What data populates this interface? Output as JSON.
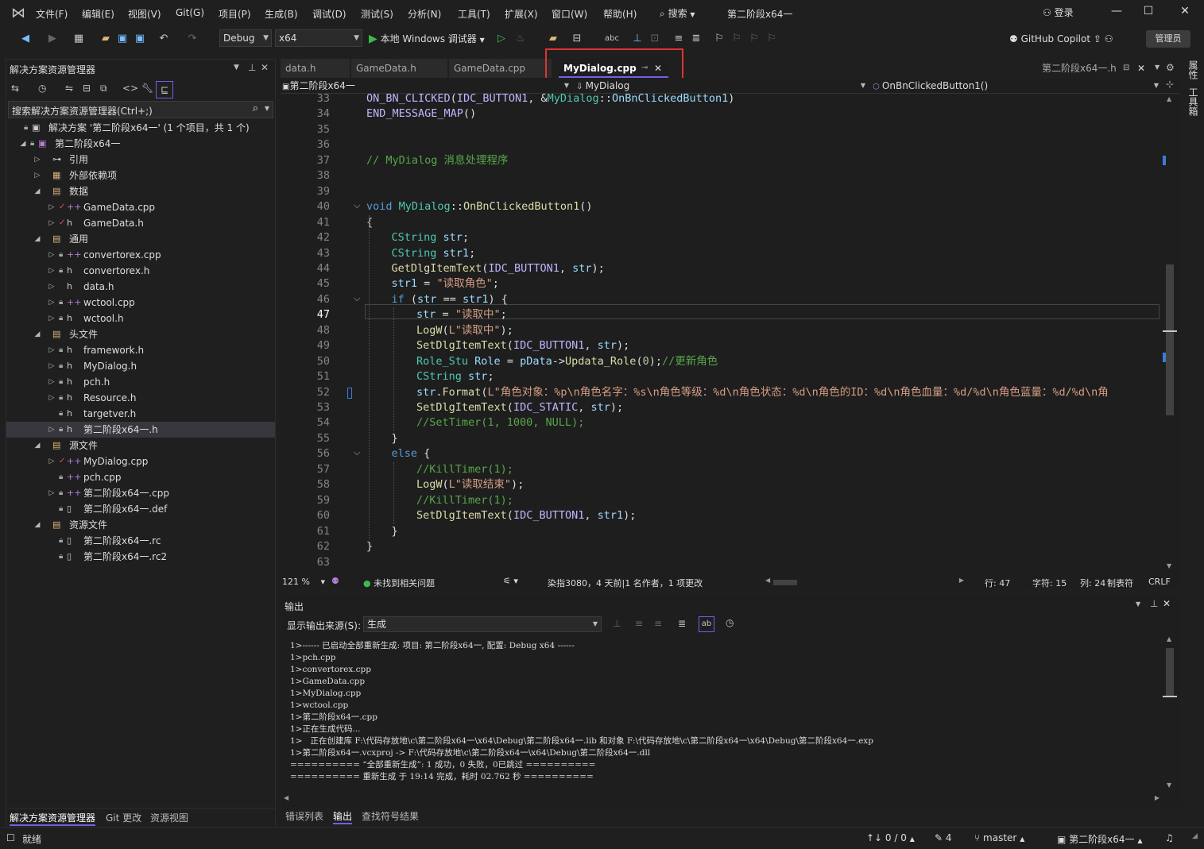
{
  "menu": [
    "文件(F)",
    "编辑(E)",
    "视图(V)",
    "Git(G)",
    "项目(P)",
    "生成(B)",
    "调试(D)",
    "测试(S)",
    "分析(N)",
    "工具(T)",
    "扩展(X)",
    "窗口(W)",
    "帮助(H)"
  ],
  "search_label": "搜索",
  "window_title": "第二阶段x64一",
  "signin": "登录",
  "toolbar": {
    "config": "Debug",
    "platform": "x64",
    "run_label": "本地 Windows 调试器",
    "copilot": "GitHub Copilot",
    "admin": "管理员"
  },
  "solution": {
    "title": "解决方案资源管理器",
    "search_placeholder": "搜索解决方案资源管理器(Ctrl+;)",
    "rows": [
      {
        "label": "解决方案 '第二阶段x64一' (1 个项目，共 1 个)",
        "glyph": "▣"
      },
      {
        "label": "第二阶段x64一",
        "glyph": "▣"
      },
      {
        "label": "引用",
        "glyph": "⊶"
      },
      {
        "label": "外部依赖项",
        "glyph": "▦"
      },
      {
        "label": "数据",
        "glyph": "▤"
      },
      {
        "label": "GameData.cpp",
        "glyph": "++"
      },
      {
        "label": "GameData.h",
        "glyph": "h"
      },
      {
        "label": "通用",
        "glyph": "▤"
      },
      {
        "label": "convertorex.cpp",
        "glyph": "++"
      },
      {
        "label": "convertorex.h",
        "glyph": "h"
      },
      {
        "label": "data.h",
        "glyph": "h"
      },
      {
        "label": "wctool.cpp",
        "glyph": "++"
      },
      {
        "label": "wctool.h",
        "glyph": "h"
      },
      {
        "label": "头文件",
        "glyph": "▤"
      },
      {
        "label": "framework.h",
        "glyph": "h"
      },
      {
        "label": "MyDialog.h",
        "glyph": "h"
      },
      {
        "label": "pch.h",
        "glyph": "h"
      },
      {
        "label": "Resource.h",
        "glyph": "h"
      },
      {
        "label": "targetver.h",
        "glyph": "h"
      },
      {
        "label": "第二阶段x64一.h",
        "glyph": "h"
      },
      {
        "label": "源文件",
        "glyph": "▤"
      },
      {
        "label": "MyDialog.cpp",
        "glyph": "++"
      },
      {
        "label": "pch.cpp",
        "glyph": "++"
      },
      {
        "label": "第二阶段x64一.cpp",
        "glyph": "++"
      },
      {
        "label": "第二阶段x64一.def",
        "glyph": "▯"
      },
      {
        "label": "资源文件",
        "glyph": "▤"
      },
      {
        "label": "第二阶段x64一.rc",
        "glyph": "▯"
      },
      {
        "label": "第二阶段x64一.rc2",
        "glyph": "▯"
      }
    ],
    "bottom_tabs": [
      "解决方案资源管理器",
      "Git 更改",
      "资源视图"
    ]
  },
  "editor": {
    "tabs": [
      "data.h",
      "GameData.h",
      "GameData.cpp",
      "MyDialog.cpp"
    ],
    "right_tab": "第二阶段x64一.h",
    "nav": {
      "project": "第二阶段x64一",
      "scope": "MyDialog",
      "member": "OnBnClickedButton1()"
    },
    "line_numbers": [
      "33",
      "34",
      "35",
      "36",
      "37",
      "38",
      "39",
      "40",
      "41",
      "42",
      "43",
      "44",
      "45",
      "46",
      "47",
      "48",
      "49",
      "50",
      "51",
      "52",
      "53",
      "54",
      "55",
      "56",
      "57",
      "58",
      "59",
      "60",
      "61",
      "62",
      "63"
    ],
    "code": [
      "ON_BN_CLICKED(IDC_BUTTON1, &MyDialog::OnBnClickedButton1)",
      "END_MESSAGE_MAP()",
      "",
      "",
      "// MyDialog 消息处理程序",
      "",
      "",
      "void MyDialog::OnBnClickedButton1()",
      "{",
      "CString str;",
      "CString str1;",
      "GetDlgItemText(IDC_BUTTON1, str);",
      "str1 = \"读取角色\";",
      "if (str == str1) {",
      "str = \"读取中\";",
      "LogW(L\"读取中\");",
      "SetDlgItemText(IDC_BUTTON1, str);",
      "Role_Stu Role = pData->Updata_Role(0);//更新角色",
      "CString str;",
      "str.Format(L\"角色对象：%p\\n角色名字：%s\\n角色等级：%d\\n角色状态：%d\\n角色的ID：%d\\n角色血量：%d/%d\\n角色蓝量：%d/%d\\n角",
      "SetDlgItemText(IDC_STATIC, str);",
      "//SetTimer(1, 1000, NULL);",
      "}",
      "else {",
      "//KillTimer(1);",
      "LogW(L\"读取结束\");",
      "//KillTimer(1);",
      "SetDlgItemText(IDC_BUTTON1, str1);",
      "}",
      "}",
      ""
    ],
    "status": {
      "zoom": "121 %",
      "issues": "未找到相关问题",
      "blame": "染指3080，4 天前|1 名作者，1 项更改",
      "line": "行: 47",
      "char": "字符: 15",
      "col": "列: 24",
      "tabs": "制表符",
      "eol": "CRLF"
    }
  },
  "output": {
    "title": "输出",
    "source_label": "显示输出来源(S):",
    "source_value": "生成",
    "lines": [
      "1>------ 已启动全部重新生成: 项目: 第二阶段x64一, 配置: Debug x64 ------",
      "1>pch.cpp",
      "1>convertorex.cpp",
      "1>GameData.cpp",
      "1>MyDialog.cpp",
      "1>wctool.cpp",
      "1>第二阶段x64一.cpp",
      "1>正在生成代码...",
      "1>   正在创建库 F:\\代码存放地\\c\\第二阶段x64一\\x64\\Debug\\第二阶段x64一.lib 和对象 F:\\代码存放地\\c\\第二阶段x64一\\x64\\Debug\\第二阶段x64一.exp",
      "1>第二阶段x64一.vcxproj -> F:\\代码存放地\\c\\第二阶段x64一\\x64\\Debug\\第二阶段x64一.dll",
      "========== “全部重新生成”: 1 成功，0 失败，0已跳过 ==========",
      "========== 重新生成 于 19:14 完成，耗时 02.762 秒 =========="
    ],
    "bottom_tabs": [
      "错误列表",
      "输出",
      "查找符号结果"
    ]
  },
  "statusbar": {
    "ready": "就绪",
    "changes": "↑↓ 0 / 0",
    "pencil": "4",
    "branch": "master",
    "project": "第二阶段x64一"
  },
  "right_rail": [
    "属性",
    "工具箱"
  ],
  "colors": {
    "accent": "#7160e8",
    "highlight_box": "#e03434"
  }
}
